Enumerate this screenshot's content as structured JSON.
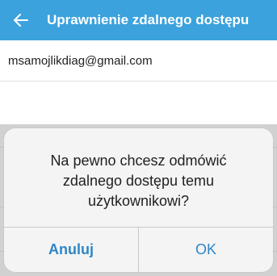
{
  "header": {
    "title": "Uprawnienie zdalnego dostępu",
    "back_icon": "arrow-left-icon",
    "background_color": "#3ba2dd"
  },
  "list": {
    "email": "msamojlikdiag@gmail.com"
  },
  "dialog": {
    "message": "Na pewno chcesz odmówić zdalnego dostępu temu użytkownikowi?",
    "cancel_label": "Anuluj",
    "ok_label": "OK",
    "button_color": "#2e86c8"
  }
}
